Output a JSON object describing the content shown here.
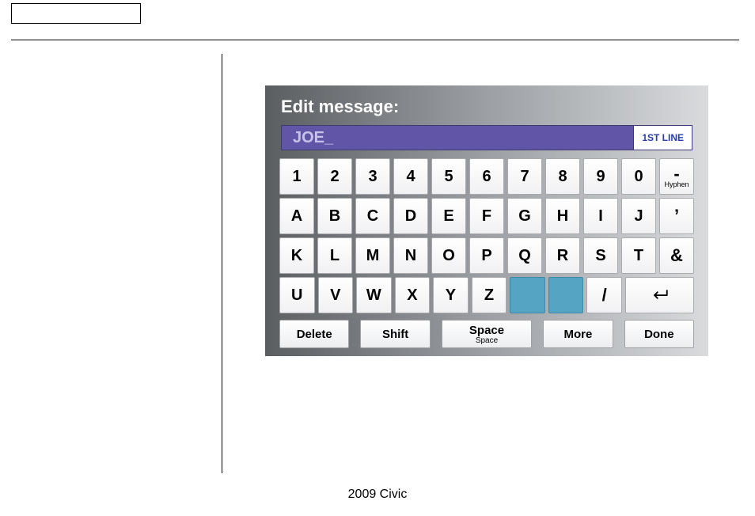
{
  "footer": "2009  Civic",
  "screen": {
    "title": "Edit message:",
    "input_value": "JOE_",
    "line_badge": "1ST LINE",
    "rows": [
      [
        {
          "label": "1"
        },
        {
          "label": "2"
        },
        {
          "label": "3"
        },
        {
          "label": "4"
        },
        {
          "label": "5"
        },
        {
          "label": "6"
        },
        {
          "label": "7"
        },
        {
          "label": "8"
        },
        {
          "label": "9"
        },
        {
          "label": "0"
        },
        {
          "label": "-",
          "sub": "Hyphen",
          "name": "key-hyphen"
        }
      ],
      [
        {
          "label": "A"
        },
        {
          "label": "B"
        },
        {
          "label": "C"
        },
        {
          "label": "D"
        },
        {
          "label": "E"
        },
        {
          "label": "F"
        },
        {
          "label": "G"
        },
        {
          "label": "H"
        },
        {
          "label": "I"
        },
        {
          "label": "J"
        },
        {
          "label": "’",
          "name": "key-apostrophe"
        }
      ],
      [
        {
          "label": "K"
        },
        {
          "label": "L"
        },
        {
          "label": "M"
        },
        {
          "label": "N"
        },
        {
          "label": "O"
        },
        {
          "label": "P"
        },
        {
          "label": "Q"
        },
        {
          "label": "R"
        },
        {
          "label": "S"
        },
        {
          "label": "T"
        },
        {
          "label": "&",
          "name": "key-ampersand"
        }
      ],
      [
        {
          "label": "U"
        },
        {
          "label": "V"
        },
        {
          "label": "W"
        },
        {
          "label": "X"
        },
        {
          "label": "Y"
        },
        {
          "label": "Z"
        },
        {
          "label": "",
          "blank": true,
          "name": "key-blank-1"
        },
        {
          "label": "",
          "blank": true,
          "name": "key-blank-2"
        },
        {
          "label": "/",
          "name": "key-slash"
        },
        {
          "label": "",
          "enter": true,
          "wide": 2,
          "name": "key-enter"
        }
      ]
    ],
    "fn": [
      {
        "label": "Delete",
        "name": "fn-delete"
      },
      {
        "label": "Shift",
        "name": "fn-shift"
      },
      {
        "label": "Space",
        "sub": "Space",
        "name": "fn-space",
        "space": true
      },
      {
        "label": "More",
        "name": "fn-more"
      },
      {
        "label": "Done",
        "name": "fn-done"
      }
    ]
  }
}
